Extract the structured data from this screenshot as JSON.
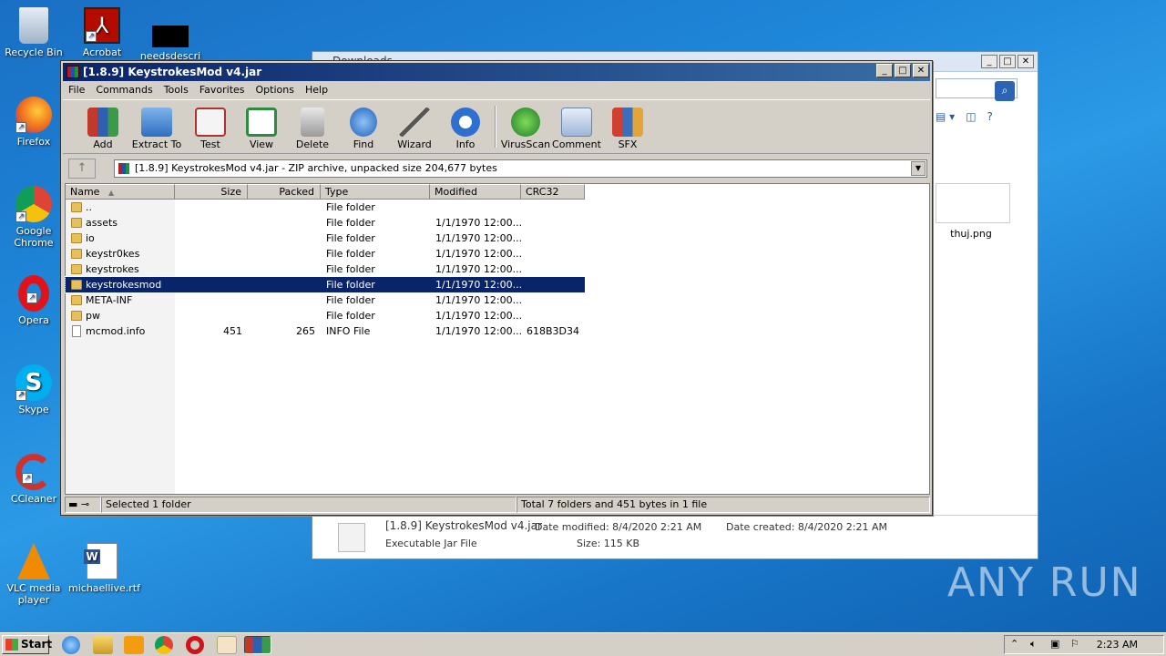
{
  "desktop_icons": [
    {
      "label": "Recycle Bin"
    },
    {
      "label": "Firefox"
    },
    {
      "label": "Google Chrome"
    },
    {
      "label": "Opera"
    },
    {
      "label": "Skype"
    },
    {
      "label": "CCleaner"
    },
    {
      "label": "VLC media player"
    },
    {
      "label": "Acrobat"
    },
    {
      "label": "needsdescri"
    },
    {
      "label": "michaellive.rtf"
    }
  ],
  "bg_window": {
    "title": "Downloads",
    "thumb_label": "thuj.png",
    "details": {
      "name": "[1.8.9] KeystrokesMod v4.jar",
      "type": "Executable Jar File",
      "modified": "Date modified: 8/4/2020 2:21 AM",
      "created": "Date created: 8/4/2020 2:21 AM",
      "size": "Size: 115 KB"
    }
  },
  "rar": {
    "title": "[1.8.9] KeystrokesMod v4.jar",
    "menu": [
      "File",
      "Commands",
      "Tools",
      "Favorites",
      "Options",
      "Help"
    ],
    "toolbar": [
      "Add",
      "Extract To",
      "Test",
      "View",
      "Delete",
      "Find",
      "Wizard",
      "Info",
      "VirusScan",
      "Comment",
      "SFX"
    ],
    "path": "[1.8.9] KeystrokesMod v4.jar - ZIP archive, unpacked size 204,677 bytes",
    "columns": [
      "Name",
      "Size",
      "Packed",
      "Type",
      "Modified",
      "CRC32"
    ],
    "rows": [
      {
        "name": "..",
        "size": "",
        "packed": "",
        "type": "File folder",
        "modified": "",
        "crc": ""
      },
      {
        "name": "assets",
        "size": "",
        "packed": "",
        "type": "File folder",
        "modified": "1/1/1970 12:00...",
        "crc": ""
      },
      {
        "name": "io",
        "size": "",
        "packed": "",
        "type": "File folder",
        "modified": "1/1/1970 12:00...",
        "crc": ""
      },
      {
        "name": "keystr0kes",
        "size": "",
        "packed": "",
        "type": "File folder",
        "modified": "1/1/1970 12:00...",
        "crc": ""
      },
      {
        "name": "keystrokes",
        "size": "",
        "packed": "",
        "type": "File folder",
        "modified": "1/1/1970 12:00...",
        "crc": ""
      },
      {
        "name": "keystrokesmod",
        "size": "",
        "packed": "",
        "type": "File folder",
        "modified": "1/1/1970 12:00...",
        "crc": ""
      },
      {
        "name": "META-INF",
        "size": "",
        "packed": "",
        "type": "File folder",
        "modified": "1/1/1970 12:00...",
        "crc": ""
      },
      {
        "name": "pw",
        "size": "",
        "packed": "",
        "type": "File folder",
        "modified": "1/1/1970 12:00...",
        "crc": ""
      },
      {
        "name": "mcmod.info",
        "size": "451",
        "packed": "265",
        "type": "INFO File",
        "modified": "1/1/1970 12:00...",
        "crc": "618B3D34"
      }
    ],
    "selected_index": 5,
    "status_left": "Selected 1 folder",
    "status_right": "Total 7 folders and 451 bytes in 1 file"
  },
  "taskbar": {
    "start": "Start",
    "clock": "2:23 AM"
  },
  "watermark": "ANY RUN"
}
